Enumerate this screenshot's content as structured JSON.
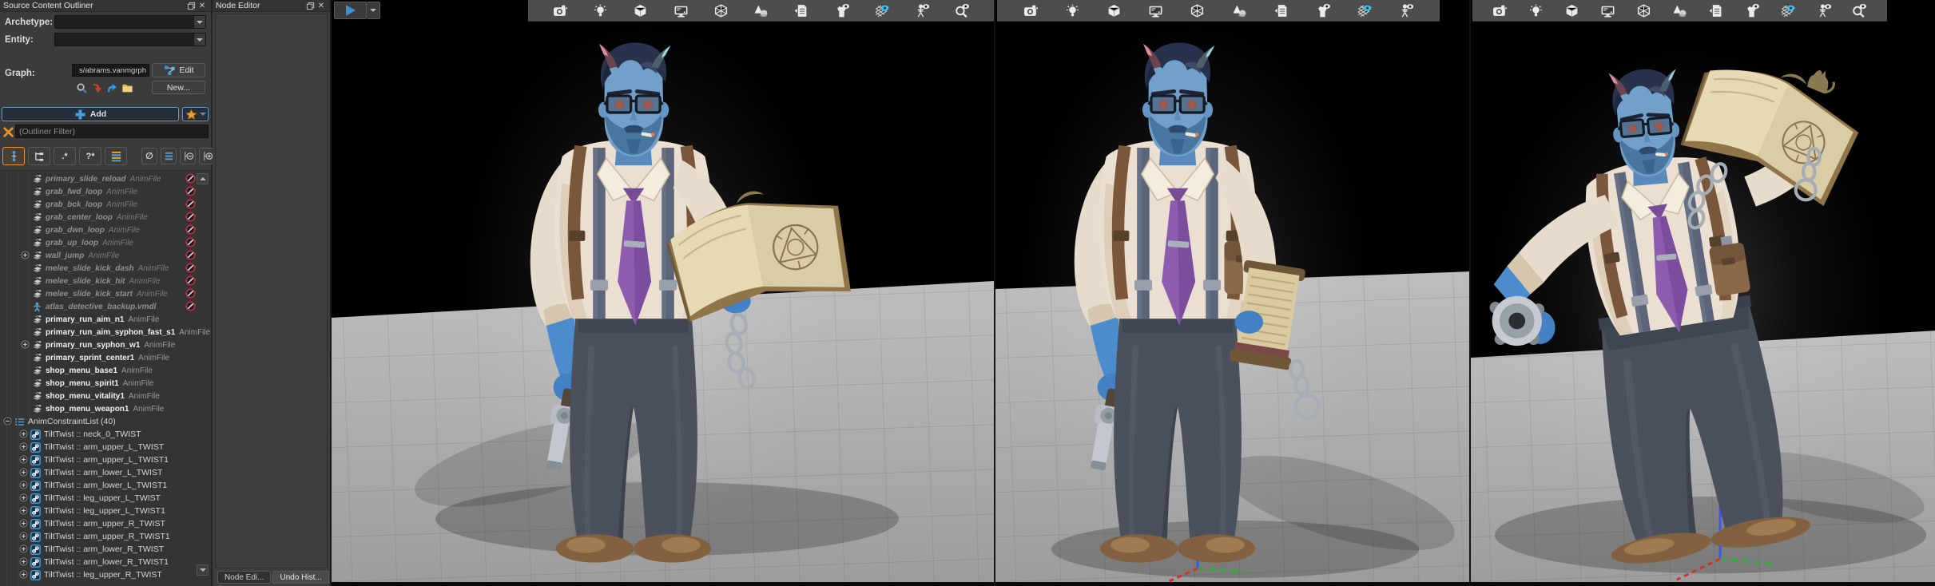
{
  "outliner": {
    "title": "Source Content Outliner",
    "archetype_label": "Archetype:",
    "entity_label": "Entity:",
    "graph_label": "Graph:",
    "graph_value": "s/abrams.vanmgrph",
    "edit_button": "Edit",
    "new_button": "New...",
    "add_button": "Add",
    "filter_placeholder": "(Outliner Filter)",
    "view_toolbar": [
      {
        "name": "scope-hierarchy-icon",
        "active": true
      },
      {
        "name": "flat-tree-icon",
        "active": false
      },
      {
        "name": "dot-star-filter-button",
        "text": ".*",
        "active": false
      },
      {
        "name": "question-star-filter-button",
        "text": "?*",
        "active": false
      },
      {
        "name": "sort-lines-icon",
        "active": false
      },
      {
        "name": "hide-empty-button",
        "text": "∅",
        "active": false,
        "narrow": true
      },
      {
        "name": "list-view-icon",
        "active": false,
        "narrow": true
      },
      {
        "name": "collapse-all-icon",
        "active": false,
        "narrow": true
      },
      {
        "name": "expand-all-icon",
        "active": false,
        "narrow": true
      }
    ],
    "tree_items": [
      {
        "name": "primary_slide_reload",
        "suffix": "AnimFile",
        "kind": "anim",
        "state": "muted",
        "expander": "none",
        "blocked": true
      },
      {
        "name": "grab_fwd_loop",
        "suffix": "AnimFile",
        "kind": "anim",
        "state": "muted",
        "expander": "none",
        "blocked": true
      },
      {
        "name": "grab_bck_loop",
        "suffix": "AnimFile",
        "kind": "anim",
        "state": "muted",
        "expander": "none",
        "blocked": true
      },
      {
        "name": "grab_center_loop",
        "suffix": "AnimFile",
        "kind": "anim",
        "state": "muted",
        "expander": "none",
        "blocked": true
      },
      {
        "name": "grab_dwn_loop",
        "suffix": "AnimFile",
        "kind": "anim",
        "state": "muted",
        "expander": "none",
        "blocked": true
      },
      {
        "name": "grab_up_loop",
        "suffix": "AnimFile",
        "kind": "anim",
        "state": "muted",
        "expander": "none",
        "blocked": true
      },
      {
        "name": "wall_jump",
        "suffix": "AnimFile",
        "kind": "anim",
        "state": "muted",
        "expander": "plus",
        "blocked": true
      },
      {
        "name": "melee_slide_kick_dash",
        "suffix": "AnimFile",
        "kind": "anim",
        "state": "muted",
        "expander": "none",
        "blocked": true
      },
      {
        "name": "melee_slide_kick_hit",
        "suffix": "AnimFile",
        "kind": "anim",
        "state": "muted",
        "expander": "none",
        "blocked": true
      },
      {
        "name": "melee_slide_kick_start",
        "suffix": "AnimFile",
        "kind": "anim",
        "state": "muted",
        "expander": "none",
        "blocked": true
      },
      {
        "name": "atlas_detective_backup.vmdl",
        "suffix": "",
        "kind": "model",
        "state": "muted",
        "expander": "none",
        "blocked": true
      },
      {
        "name": "primary_run_aim_n1",
        "suffix": "AnimFile",
        "kind": "anim",
        "state": "active",
        "expander": "none",
        "blocked": false
      },
      {
        "name": "primary_run_aim_syphon_fast_s1",
        "suffix": "AnimFile",
        "kind": "anim",
        "state": "active",
        "expander": "none",
        "blocked": false
      },
      {
        "name": "primary_run_syphon_w1",
        "suffix": "AnimFile",
        "kind": "anim",
        "state": "active",
        "expander": "plus",
        "blocked": false
      },
      {
        "name": "primary_sprint_center1",
        "suffix": "AnimFile",
        "kind": "anim",
        "state": "active",
        "expander": "none",
        "blocked": false
      },
      {
        "name": "shop_menu_base1",
        "suffix": "AnimFile",
        "kind": "anim",
        "state": "active",
        "expander": "none",
        "blocked": false
      },
      {
        "name": "shop_menu_spirit1",
        "suffix": "AnimFile",
        "kind": "anim",
        "state": "active",
        "expander": "none",
        "blocked": false
      },
      {
        "name": "shop_menu_vitality1",
        "suffix": "AnimFile",
        "kind": "anim",
        "state": "active",
        "expander": "none",
        "blocked": false
      },
      {
        "name": "shop_menu_weapon1",
        "suffix": "AnimFile",
        "kind": "anim",
        "state": "active",
        "expander": "none",
        "blocked": false
      },
      {
        "name": "AnimConstraintList (40)",
        "suffix": "",
        "kind": "group",
        "state": "active",
        "expander": "minus",
        "blocked": false
      },
      {
        "name": "TiltTwist :: neck_0_TWIST",
        "suffix": "",
        "kind": "constraint",
        "state": "active",
        "expander": "plus",
        "blocked": false
      },
      {
        "name": "TiltTwist :: arm_upper_L_TWIST",
        "suffix": "",
        "kind": "constraint",
        "state": "active",
        "expander": "plus",
        "blocked": false
      },
      {
        "name": "TiltTwist :: arm_upper_L_TWIST1",
        "suffix": "",
        "kind": "constraint",
        "state": "active",
        "expander": "plus",
        "blocked": false
      },
      {
        "name": "TiltTwist :: arm_lower_L_TWIST",
        "suffix": "",
        "kind": "constraint",
        "state": "active",
        "expander": "plus",
        "blocked": false
      },
      {
        "name": "TiltTwist :: arm_lower_L_TWIST1",
        "suffix": "",
        "kind": "constraint",
        "state": "active",
        "expander": "plus",
        "blocked": false
      },
      {
        "name": "TiltTwist :: leg_upper_L_TWIST",
        "suffix": "",
        "kind": "constraint",
        "state": "active",
        "expander": "plus",
        "blocked": false
      },
      {
        "name": "TiltTwist :: leg_upper_L_TWIST1",
        "suffix": "",
        "kind": "constraint",
        "state": "active",
        "expander": "plus",
        "blocked": false
      },
      {
        "name": "TiltTwist :: arm_upper_R_TWIST",
        "suffix": "",
        "kind": "constraint",
        "state": "active",
        "expander": "plus",
        "blocked": false
      },
      {
        "name": "TiltTwist :: arm_upper_R_TWIST1",
        "suffix": "",
        "kind": "constraint",
        "state": "active",
        "expander": "plus",
        "blocked": false
      },
      {
        "name": "TiltTwist :: arm_lower_R_TWIST",
        "suffix": "",
        "kind": "constraint",
        "state": "active",
        "expander": "plus",
        "blocked": false
      },
      {
        "name": "TiltTwist :: arm_lower_R_TWIST1",
        "suffix": "",
        "kind": "constraint",
        "state": "active",
        "expander": "plus",
        "blocked": false
      },
      {
        "name": "TiltTwist :: leg_upper_R_TWIST",
        "suffix": "",
        "kind": "constraint",
        "state": "active",
        "expander": "plus",
        "blocked": false
      }
    ]
  },
  "node_editor": {
    "title": "Node Editor",
    "tabs": [
      "Node Edi...",
      "Undo Hist..."
    ]
  },
  "viewports": [
    {
      "name": "viewport-1",
      "toolbar_icons": [
        "camera-icon",
        "light-icon",
        "cube-icon",
        "monitor-icon",
        "wireframe-cube-icon",
        "primitives-icon",
        "mesh-page-icon",
        "cloth-visibility-icon",
        "collision-grid-icon",
        "skeleton-visibility-icon",
        "physics-query-icon"
      ],
      "active_icon": "collision-grid-icon"
    },
    {
      "name": "viewport-2",
      "toolbar_icons": [
        "camera-icon",
        "light-icon",
        "cube-icon",
        "monitor-icon",
        "wireframe-cube-icon",
        "primitives-icon",
        "mesh-page-icon",
        "cloth-visibility-icon",
        "collision-grid-icon",
        "skeleton-visibility-icon"
      ],
      "active_icon": "collision-grid-icon"
    },
    {
      "name": "viewport-3",
      "toolbar_icons": [
        "camera-icon",
        "light-icon",
        "cube-icon",
        "monitor-icon",
        "wireframe-cube-icon",
        "primitives-icon",
        "mesh-page-icon",
        "cloth-visibility-icon",
        "collision-grid-icon",
        "skeleton-visibility-icon",
        "physics-query-icon"
      ],
      "active_icon": "collision-grid-icon"
    }
  ],
  "colors": {
    "accent_orange": "#e8952a",
    "accent_blue": "#4f9fd6",
    "blocked_red": "#c23347",
    "active_eye_blue": "#35c3f5",
    "viewport_bg": "#000000",
    "ground_gray": "#aaaaaa"
  }
}
